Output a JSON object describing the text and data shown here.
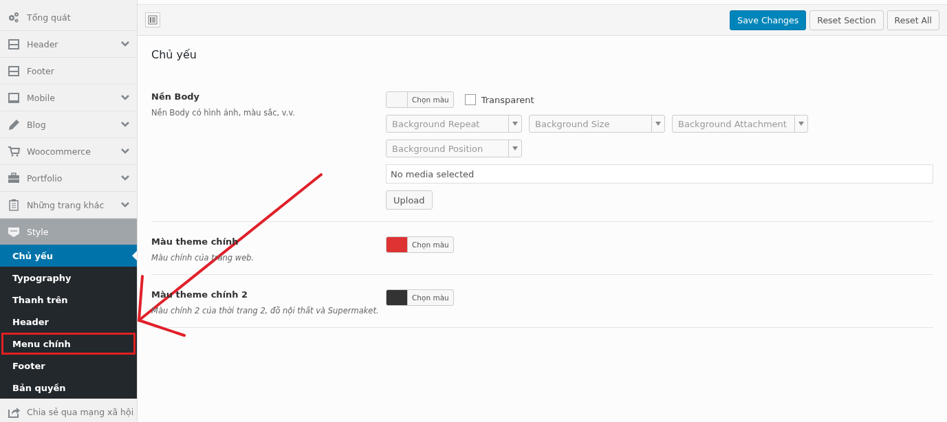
{
  "sidebar": {
    "items": [
      {
        "label": "Tổng quát",
        "expandable": false
      },
      {
        "label": "Header",
        "expandable": true
      },
      {
        "label": "Footer",
        "expandable": false
      },
      {
        "label": "Mobile",
        "expandable": true
      },
      {
        "label": "Blog",
        "expandable": true
      },
      {
        "label": "Woocommerce",
        "expandable": true
      },
      {
        "label": "Portfolio",
        "expandable": true
      },
      {
        "label": "Những trang khác",
        "expandable": true
      },
      {
        "label": "Style",
        "expandable": false,
        "expanded": true,
        "children": [
          {
            "label": "Chủ yếu",
            "selected": true,
            "highlighted": false
          },
          {
            "label": "Typography",
            "selected": false,
            "highlighted": false
          },
          {
            "label": "Thanh trên",
            "selected": false,
            "highlighted": false
          },
          {
            "label": "Header",
            "selected": false,
            "highlighted": false
          },
          {
            "label": "Menu chính",
            "selected": false,
            "highlighted": true
          },
          {
            "label": "Footer",
            "selected": false,
            "highlighted": false
          },
          {
            "label": "Bản quyền",
            "selected": false,
            "highlighted": false
          }
        ]
      },
      {
        "label": "Chia sẻ qua mạng xã hội"
      }
    ]
  },
  "toolbar": {
    "buttons": [
      {
        "label": "Save Changes",
        "kind": "primary"
      },
      {
        "label": "Reset Section",
        "kind": "secondary"
      },
      {
        "label": "Reset All",
        "kind": "secondary"
      }
    ]
  },
  "section_title": "Chủ yếu",
  "settings": [
    {
      "title": "Nền Body",
      "description": "Nền Body có hình ảnh, màu sắc, v.v.",
      "italic": false,
      "color_button": "Chọn màu",
      "color": "#f7f7f7",
      "transparent": {
        "label": "Transparent",
        "checked": false
      },
      "selects": [
        {
          "placeholder": "Background Repeat"
        },
        {
          "placeholder": "Background Size"
        },
        {
          "placeholder": "Background Attachment"
        },
        {
          "placeholder": "Background Position"
        }
      ],
      "media": {
        "value": "No media selected",
        "button": "Upload"
      }
    },
    {
      "title": "Màu theme chính",
      "description": "Màu chính của trang web.",
      "italic": true,
      "color_button": "Chọn màu",
      "color": "#dd3333"
    },
    {
      "title": "Màu theme chính 2",
      "description": "Màu chính 2 của thời trang 2, đồ nội thất và Supermaket.",
      "italic": true,
      "color_button": "Chọn màu",
      "color": "#333333"
    }
  ]
}
